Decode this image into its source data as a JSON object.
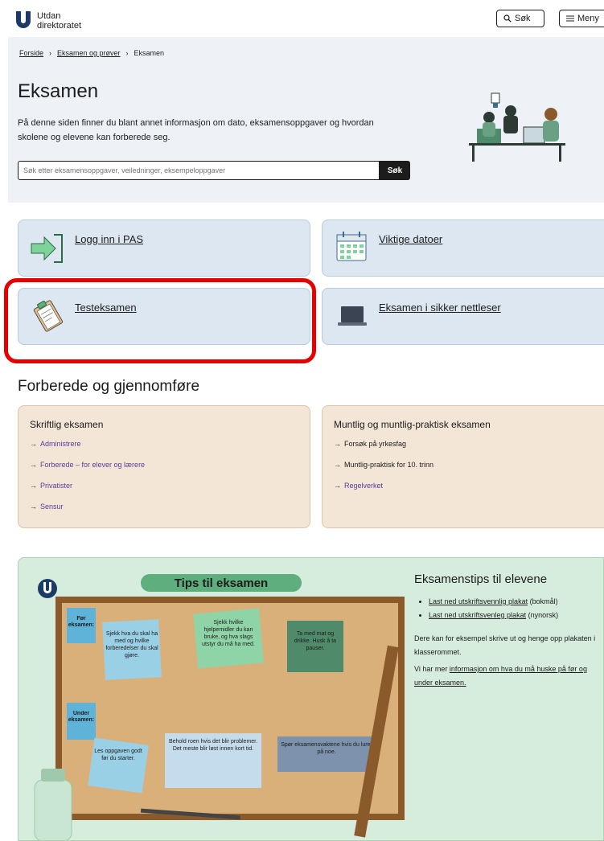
{
  "overlay_text": "Eksamen og prøver",
  "header": {
    "logo_text_line1": "Utdanningsdirektoratet",
    "logo_text_line2": "direktoratet",
    "search_label": "Søk",
    "menu_label": "Meny"
  },
  "breadcrumb": [
    "Forside",
    "Eksamen og prøver",
    "Eksamen"
  ],
  "page": {
    "title": "Eksamen",
    "intro": "På denne siden finner du blant annet informasjon om dato, eksamensoppgaver og hvordan skolene og elevene kan forberede seg.",
    "search_placeholder": "Søk etter eksamensoppgaver, veiledninger, eksempeloppgaver",
    "search_button": "Søk"
  },
  "cards": [
    {
      "label": "Logg inn i PAS",
      "icon": "login-arrow-icon"
    },
    {
      "label": "Viktige datoer",
      "icon": "calendar-icon"
    },
    {
      "label": "Testeksamen",
      "icon": "clipboard-icon"
    },
    {
      "label": "Eksamen i sikker nettleser",
      "icon": "laptop-icon"
    }
  ],
  "section_title": "Forberede og gjennomføre",
  "prep": [
    {
      "title": "Skriftlig eksamen",
      "links": [
        "Administrere",
        "Forberede – for elever og lærere",
        "Privatister",
        "Sensur"
      ]
    },
    {
      "title": "Muntlig og muntlig-praktisk eksamen",
      "links": [
        "Forsøk på yrkesfag",
        "Muntlig-praktisk for 10. trinn",
        "Regelverket"
      ]
    }
  ],
  "tips": {
    "title": "Eksamenstips til elevene",
    "items": [
      {
        "link": "Last ned utskriftsvennlig plakat",
        "suffix": " (bokmål)"
      },
      {
        "link": "Last ned utskriftsvenleg plakat",
        "suffix": " (nynorsk)"
      }
    ],
    "para1": "Dere kan for eksempel skrive ut og henge opp plakaten i klasserommet.",
    "para2_prefix": "Vi har mer ",
    "para2_link": "informasjon om hva du må huske på før og under eksamen.",
    "poster": {
      "banner": "Tips til eksamen",
      "label_before": "Før eksamen:",
      "label_during": "Under eksamen:",
      "notes": [
        "Sjekk hva du skal ha med og hvilke forberedelser du skal gjøre.",
        "Sjekk hvilke hjelpemidler du kan bruke, og hva slags utstyr du må ha med.",
        "Ta med mat og drikke. Husk å ta pauser.",
        "Les oppgaven godt før du starter.",
        "Behold roen hvis det blir problemer. Det meste blir løst innen kort tid.",
        "Spør eksamensvaktene hvis du lurer på noe."
      ]
    }
  }
}
